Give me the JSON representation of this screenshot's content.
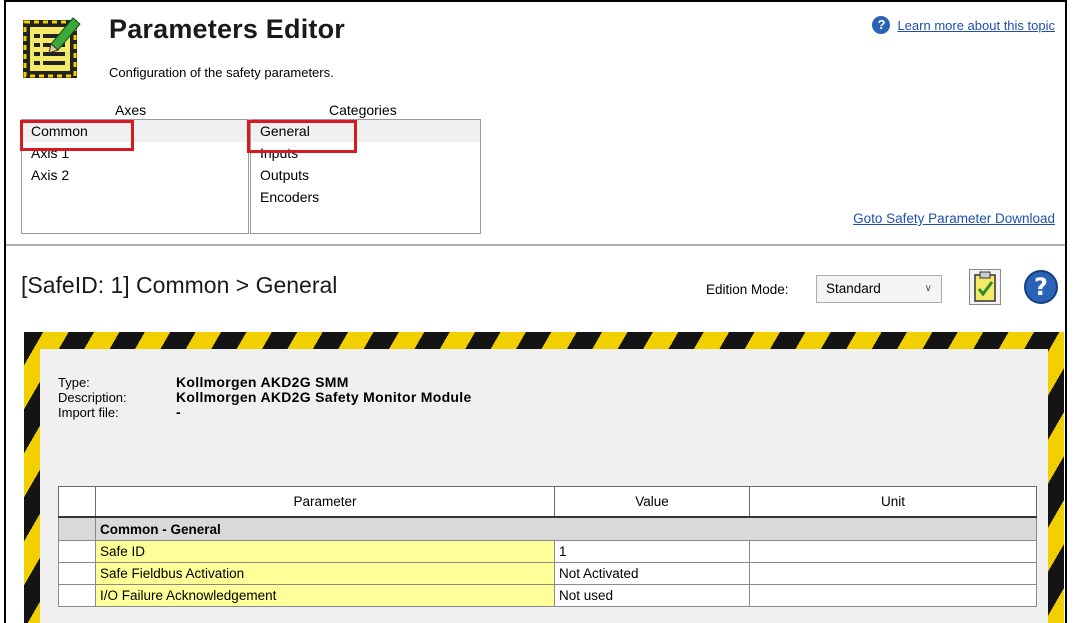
{
  "header": {
    "title": "Parameters Editor",
    "subtitle": "Configuration of the safety parameters.",
    "learn_more_link": "Learn more about this topic"
  },
  "axes": {
    "header": "Axes",
    "items": [
      {
        "label": "Common",
        "selected": true
      },
      {
        "label": "Axis 1",
        "selected": false
      },
      {
        "label": "Axis 2",
        "selected": false
      }
    ]
  },
  "categories": {
    "header": "Categories",
    "items": [
      {
        "label": "General",
        "selected": true
      },
      {
        "label": "Inputs",
        "selected": false
      },
      {
        "label": "Outputs",
        "selected": false
      },
      {
        "label": "Encoders",
        "selected": false
      }
    ]
  },
  "goto_download_link": "Goto Safety Parameter Download",
  "detail": {
    "title": "[SafeID: 1]  Common > General",
    "edition_mode_label": "Edition Mode:",
    "edition_mode_value": "Standard"
  },
  "device_info": {
    "type_label": "Type:",
    "type_value": "Kollmorgen AKD2G SMM",
    "description_label": "Description:",
    "description_value": "Kollmorgen AKD2G Safety Monitor Module",
    "import_label": "Import file:",
    "import_value": "-"
  },
  "table": {
    "columns": [
      "Parameter",
      "Value",
      "Unit"
    ],
    "group": "Common - General",
    "rows": [
      {
        "parameter": "Safe ID",
        "value": "1",
        "unit": ""
      },
      {
        "parameter": "Safe Fieldbus Activation",
        "value": "Not Activated",
        "unit": ""
      },
      {
        "parameter": "I/O Failure Acknowledgement",
        "value": "Not used",
        "unit": ""
      }
    ]
  },
  "colors": {
    "highlight_box": "#d71920",
    "link": "#1f4fb0",
    "hazard_yellow": "#f2d000",
    "hazard_black": "#141414",
    "param_cell": "#ffff99"
  }
}
